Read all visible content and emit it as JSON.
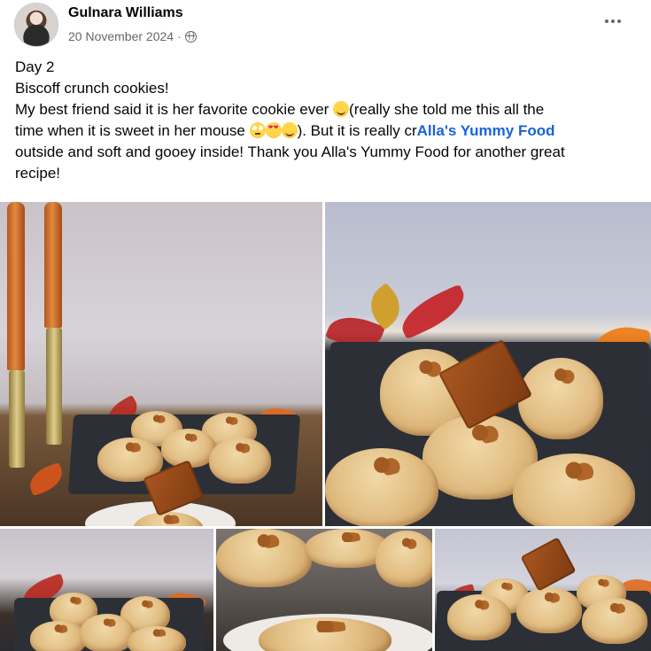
{
  "post": {
    "author": "Gulnara Williams",
    "date": "20 November 2024",
    "separator": " · ",
    "privacy_icon": "globe-icon",
    "more_icon": "more-options-icon"
  },
  "body": {
    "line1": "Day 2",
    "line2": "Biscoff crunch cookies!",
    "line3_before": "My best friend said it is her favorite cookie ever ",
    "line3_after": "(really she told me this all the",
    "line4_before": "time when it is sweet in her mouse ",
    "line4_after": "). But it is really cr",
    "mention": "Alla's Yummy Food",
    "line5": "outside and soft and gooey inside! Thank you Alla's Yummy Food for another great",
    "line6": "recipe!"
  },
  "photos": [
    {
      "name": "photo-candles-cookies"
    },
    {
      "name": "photo-cookies-closeup"
    },
    {
      "name": "photo-cookies-tray-left"
    },
    {
      "name": "photo-cookies-macro"
    },
    {
      "name": "photo-cookies-tray-right"
    }
  ],
  "colors": {
    "text": "#050505",
    "secondary": "#65676b",
    "mention": "#1664d8"
  }
}
